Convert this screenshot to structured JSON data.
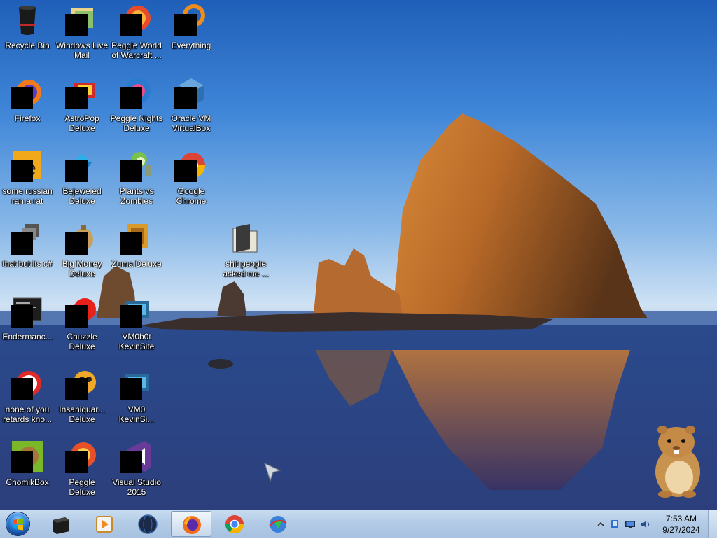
{
  "desktop": {
    "icons": [
      {
        "label": "Recycle Bin",
        "icon": "recycle-bin-icon"
      },
      {
        "label": "Windows Live\nMail",
        "icon": "mail-icon"
      },
      {
        "label": "Peggle World\nof Warcraft ...",
        "icon": "peggle-wow-icon"
      },
      {
        "label": "Everything",
        "icon": "everything-search-icon"
      },
      {
        "label": "Firefox",
        "icon": "firefox-icon"
      },
      {
        "label": "AstroPop\nDeluxe",
        "icon": "astropop-icon"
      },
      {
        "label": "Peggle Nights\nDeluxe",
        "icon": "peggle-nights-icon"
      },
      {
        "label": "Oracle VM\nVirtualBox",
        "icon": "virtualbox-icon"
      },
      {
        "label": "some russian\nran a rat",
        "icon": "document-icon"
      },
      {
        "label": "Bejeweled\nDeluxe",
        "icon": "bejeweled-icon"
      },
      {
        "label": "Plants vs\nZombies",
        "icon": "plants-vs-zombies-icon"
      },
      {
        "label": "Google\nChrome",
        "icon": "chrome-icon"
      },
      {
        "label": "that but its c#",
        "icon": "shortcut-icon"
      },
      {
        "label": "Big Money\nDeluxe",
        "icon": "big-money-icon"
      },
      {
        "label": "Zuma Deluxe",
        "icon": "zuma-icon"
      },
      {
        "label": "shit people\nasked me ...",
        "icon": "folder-icon"
      },
      {
        "label": "Endermanc...",
        "icon": "terminal-icon"
      },
      {
        "label": "Chuzzle\nDeluxe",
        "icon": "chuzzle-icon"
      },
      {
        "label": "VM0b0t\nKevinSite",
        "icon": "vm-site-icon"
      },
      {
        "label": "none of you\nretards kno...",
        "icon": "red-app-icon"
      },
      {
        "label": "Insaniquar...\nDeluxe",
        "icon": "insaniquarium-icon"
      },
      {
        "label": "VM0\nKevinSi...",
        "icon": "vm-site-icon"
      },
      {
        "label": "ChomikBox",
        "icon": "chomikbox-icon"
      },
      {
        "label": "Peggle Deluxe",
        "icon": "peggle-icon"
      },
      {
        "label": "Visual Studio\n2015",
        "icon": "visual-studio-icon"
      }
    ]
  },
  "taskbar": {
    "start": "start-orb-icon",
    "pinned": [
      {
        "icon": "terminal-window-icon",
        "active": false
      },
      {
        "icon": "media-player-icon",
        "active": false
      },
      {
        "icon": "globe-icon",
        "active": false
      },
      {
        "icon": "firefox-icon",
        "active": true
      },
      {
        "icon": "chrome-icon",
        "active": false
      },
      {
        "icon": "download-manager-icon",
        "active": false
      }
    ],
    "tray": {
      "time": "7:53 AM",
      "date": "9/27/2024"
    }
  },
  "colors": {
    "taskbar": "#b3cbe6",
    "sky": "#3f86d8",
    "rock": "#c8742a"
  }
}
